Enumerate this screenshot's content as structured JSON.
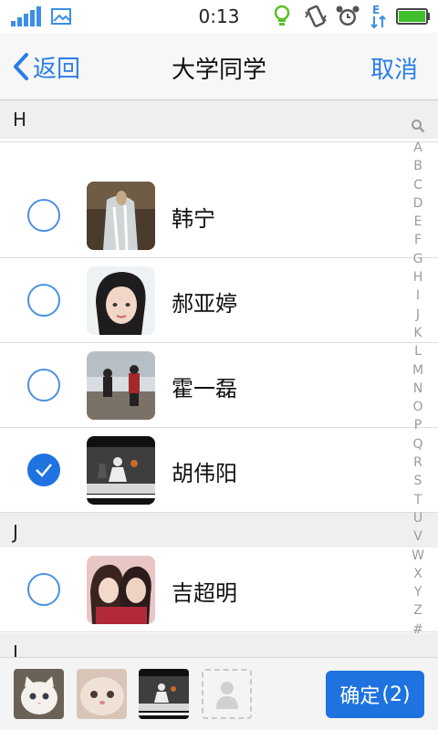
{
  "status_bar": {
    "time": "0:13",
    "colors": {
      "signal": "#3b8ee8",
      "bulb": "#5cbf2a",
      "battery": "#3fbf2c"
    }
  },
  "nav": {
    "back_label": "返回",
    "title": "大学同学",
    "cancel_label": "取消"
  },
  "sections": [
    {
      "letter": "H"
    },
    {
      "letter": "J"
    },
    {
      "letter": "L"
    }
  ],
  "contacts": [
    {
      "name": "韩宁",
      "checked": false,
      "avatar": "waterfall-photo"
    },
    {
      "name": "郝亚婷",
      "checked": false,
      "avatar": "girl-portrait-photo"
    },
    {
      "name": "霍一磊",
      "checked": false,
      "avatar": "two-people-outdoor-photo"
    },
    {
      "name": "胡伟阳",
      "checked": true,
      "avatar": "basketball-photo"
    },
    {
      "name": "吉超明",
      "checked": false,
      "avatar": "couple-photo"
    }
  ],
  "index_letters": [
    "A",
    "B",
    "C",
    "D",
    "E",
    "F",
    "G",
    "H",
    "I",
    "J",
    "K",
    "L",
    "M",
    "N",
    "O",
    "P",
    "Q",
    "R",
    "S",
    "T",
    "U",
    "V",
    "W",
    "X",
    "Y",
    "Z",
    "#"
  ],
  "bottom": {
    "confirm_label": "确定",
    "confirm_count": "(2)",
    "selected_thumbs": [
      "white-kitten-photo",
      "fluffy-kitten-photo",
      "basketball-photo"
    ]
  },
  "accent_color": "#1e73e0"
}
